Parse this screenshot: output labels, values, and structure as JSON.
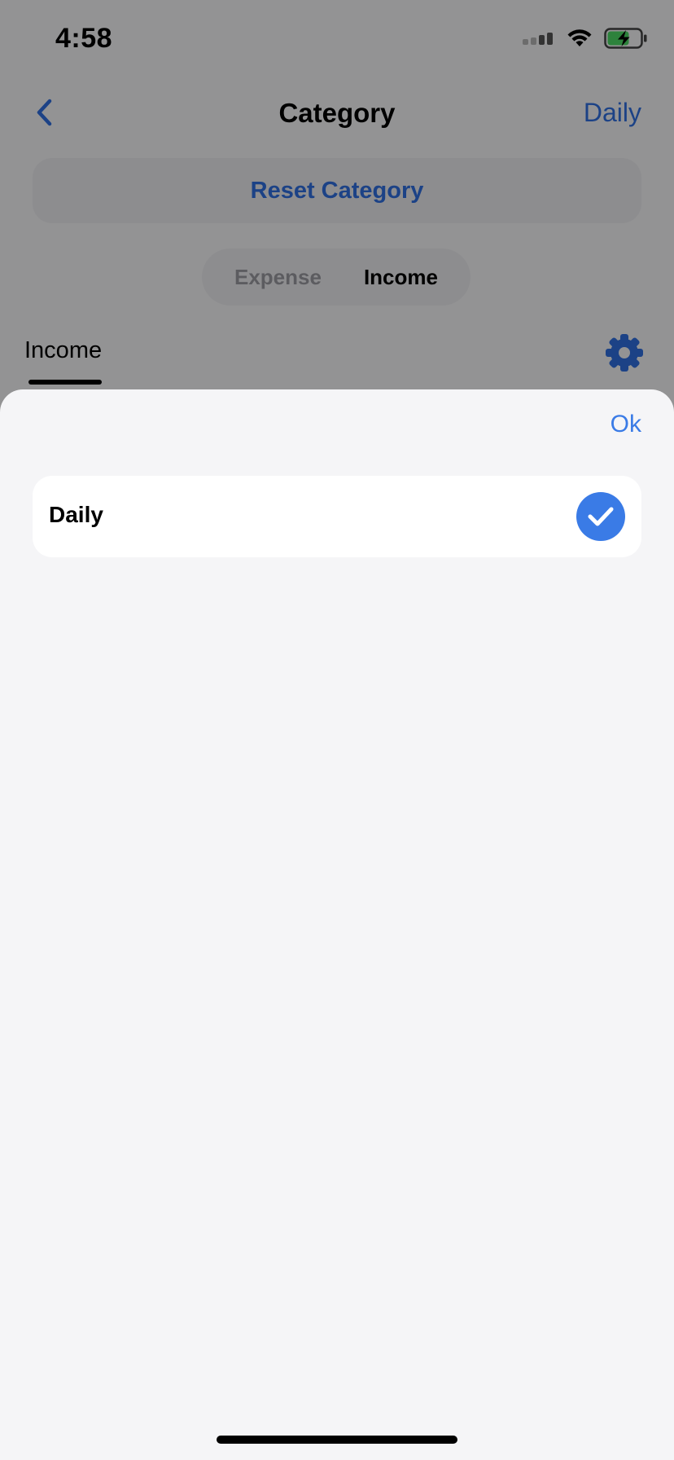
{
  "status_bar": {
    "time": "4:58",
    "icons": [
      "cellular-signal-icon",
      "wifi-icon",
      "battery-charging-icon"
    ]
  },
  "nav": {
    "title": "Category",
    "right_label": "Daily",
    "back_icon": "chevron-left-icon"
  },
  "reset_button": {
    "label": "Reset Category"
  },
  "segmented": {
    "options": [
      {
        "label": "Expense",
        "selected": false
      },
      {
        "label": "Income",
        "selected": true
      }
    ]
  },
  "tab": {
    "label": "Income",
    "settings_icon": "gear-icon"
  },
  "sheet": {
    "ok_label": "Ok",
    "options": [
      {
        "label": "Daily",
        "selected": true,
        "icon": "checkmark-circle-icon"
      }
    ]
  },
  "colors": {
    "accent": "#3a7be6",
    "link": "#2f6fe0",
    "background": "#f5f5f7",
    "card": "#ffffff",
    "battery_fill": "#4cd964"
  }
}
